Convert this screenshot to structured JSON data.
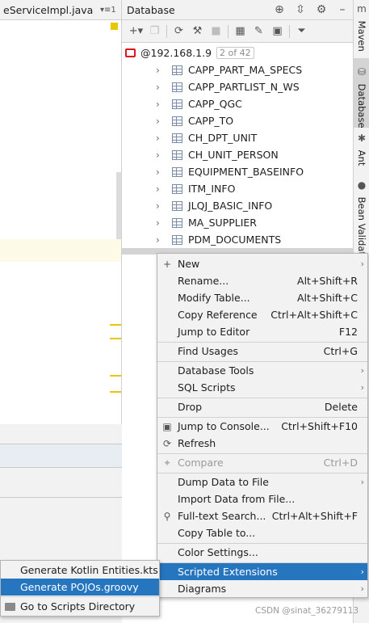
{
  "editor": {
    "tab_title": "eServiceImpl.java",
    "tab_menu": "▾≡1"
  },
  "database": {
    "title": "Database",
    "connection": {
      "host": "@192.168.1.9",
      "count": "2 of 42"
    },
    "tables": [
      "CAPP_PART_MA_SPECS",
      "CAPP_PARTLIST_N_WS",
      "CAPP_QGC",
      "CAPP_TO",
      "CH_DPT_UNIT",
      "CH_UNIT_PERSON",
      "EQUIPMENT_BASEINFO",
      "ITM_INFO",
      "JLQJ_BASIC_INFO",
      "MA_SUPPLIER",
      "PDM_DOCUMENTS"
    ]
  },
  "side_tabs": {
    "maven": "Maven",
    "database": "Database",
    "ant": "Ant",
    "bean_validation": "Bean Validation"
  },
  "context_menu": {
    "new": "New",
    "rename": "Rename...",
    "rename_sc": "Alt+Shift+R",
    "modify_table": "Modify Table...",
    "modify_table_sc": "Alt+Shift+C",
    "copy_reference": "Copy Reference",
    "copy_reference_sc": "Ctrl+Alt+Shift+C",
    "jump_to_editor": "Jump to Editor",
    "jump_to_editor_sc": "F12",
    "find_usages": "Find Usages",
    "find_usages_sc": "Ctrl+G",
    "database_tools": "Database Tools",
    "sql_scripts": "SQL Scripts",
    "drop": "Drop",
    "drop_sc": "Delete",
    "jump_to_console": "Jump to Console...",
    "jump_to_console_sc": "Ctrl+Shift+F10",
    "refresh": "Refresh",
    "compare": "Compare",
    "compare_sc": "Ctrl+D",
    "dump_data": "Dump Data to File",
    "import_data": "Import Data from File...",
    "fulltext_search": "Full-text Search...",
    "fulltext_search_sc": "Ctrl+Alt+Shift+F",
    "copy_table": "Copy Table to...",
    "color_settings": "Color Settings...",
    "scripted_extensions": "Scripted Extensions",
    "diagrams": "Diagrams"
  },
  "submenu": {
    "kotlin": "Generate Kotlin Entities.kts",
    "pojos": "Generate POJOs.groovy",
    "goto_dir": "Go to Scripts Directory"
  },
  "watermark": "CSDN @sinat_36279113",
  "colors": {
    "selection": "#2675bf",
    "oracle": "#e0141e",
    "marker": "#e8c600"
  }
}
